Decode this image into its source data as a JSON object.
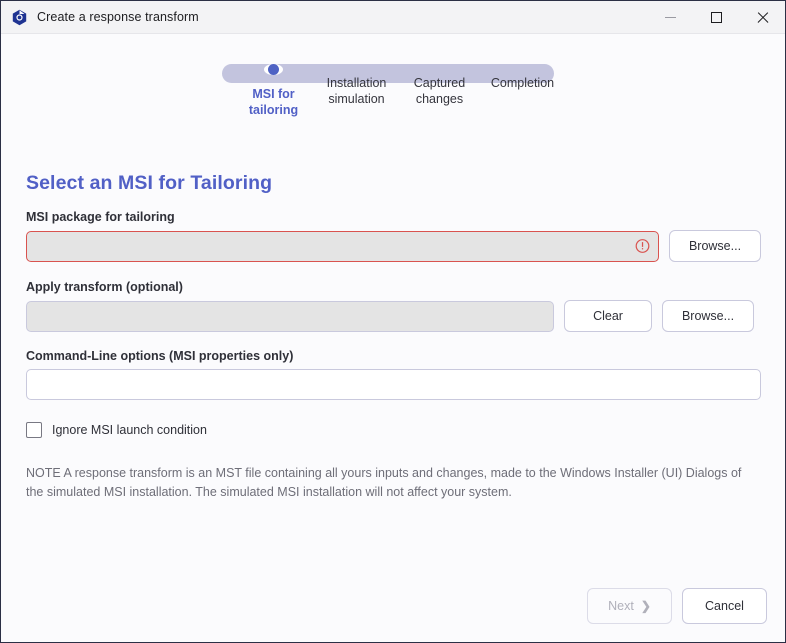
{
  "window": {
    "title": "Create a response transform",
    "logo_icon": "app-logo-icon",
    "controls": {
      "minimize": "minimize-icon",
      "maximize": "maximize-icon",
      "close": "close-icon"
    }
  },
  "stepper": {
    "steps": [
      {
        "label": "MSI for tailoring",
        "active": true
      },
      {
        "label": "Installation simulation",
        "active": false
      },
      {
        "label": "Captured changes",
        "active": false
      },
      {
        "label": "Completion",
        "active": false
      }
    ],
    "track_color": "#c3c4de",
    "active_color": "#4f63c4"
  },
  "page": {
    "heading": "Select an MSI for Tailoring",
    "heading_color": "#5160c6"
  },
  "form": {
    "msi_package": {
      "label": "MSI package for tailoring",
      "value": "",
      "placeholder": "",
      "error": true,
      "error_icon": "error-exclamation-icon",
      "error_color": "#d9534f",
      "browse_label": "Browse..."
    },
    "apply_transform": {
      "label": "Apply transform (optional)",
      "value": "",
      "placeholder": "",
      "clear_label": "Clear",
      "browse_label": "Browse..."
    },
    "command_line": {
      "label": "Command-Line options (MSI properties only)",
      "value": "",
      "placeholder": ""
    },
    "ignore_launch_condition": {
      "label": "Ignore MSI launch condition",
      "checked": false
    },
    "note": "NOTE  A response transform is an MST file containing all yours inputs and changes, made to the Windows Installer (UI) Dialogs of the simulated MSI installation. The simulated MSI installation will not affect your system."
  },
  "footer": {
    "next_label": "Next",
    "next_icon": "chevron-right-icon",
    "next_disabled": true,
    "cancel_label": "Cancel"
  }
}
